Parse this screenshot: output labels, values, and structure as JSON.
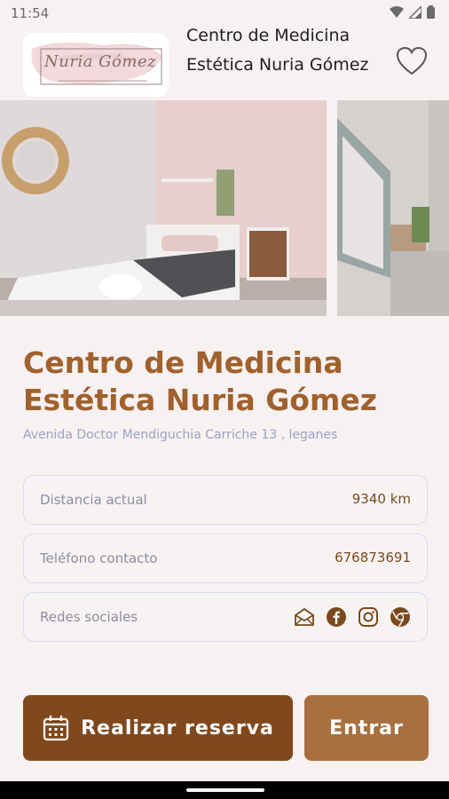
{
  "status_bar": {
    "time": "11:54"
  },
  "header": {
    "logo_text": "Nuria Gómez",
    "title": "Centro de Medicina Estética Nuria Gómez"
  },
  "business": {
    "name": "Centro de Medicina Estética Nuria Gómez",
    "address": "Avenida Doctor Mendiguchia Carriche 13 , leganes"
  },
  "info": {
    "distance_label": "Distancia actual",
    "distance_value": "9340 km",
    "phone_label": "Teléfono contacto",
    "phone_value": "676873691",
    "social_label": "Redes sociales",
    "social_icons": [
      "email-icon",
      "facebook-icon",
      "instagram-icon",
      "web-icon"
    ]
  },
  "buttons": {
    "reserve_label": "Realizar reserva",
    "enter_label": "Entrar"
  },
  "colors": {
    "accent_brown": "#a0612c",
    "button_dark": "#80491d",
    "button_light": "#a9703f",
    "address_text": "#9aa4c0",
    "background": "#f7f1f1"
  }
}
